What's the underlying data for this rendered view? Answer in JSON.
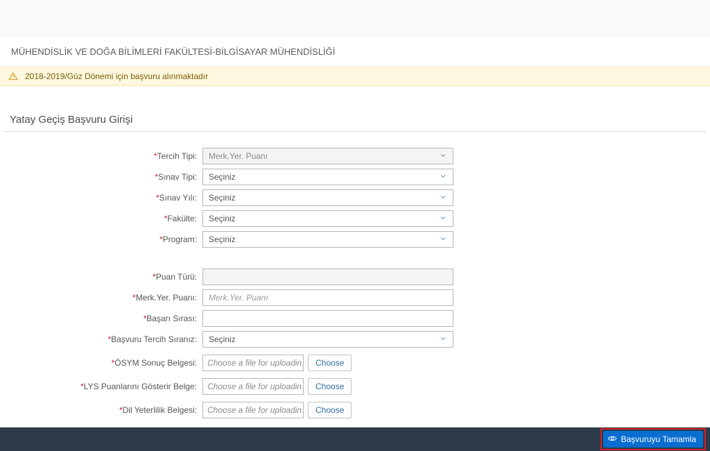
{
  "header": {
    "faculty_line": "MÜHENDİSLİK VE DOĞA BİLİMLERİ FAKÜLTESİ-BİLGİSAYAR MÜHENDİSLİĞİ"
  },
  "warning": {
    "text": "2018-2019/Güz Dönemi için başvuru alınmaktadır"
  },
  "section": {
    "title": "Yatay Geçiş Başvuru Girişi"
  },
  "labels": {
    "tercih_tipi": "Tercih Tipi:",
    "sinav_tipi": "Sınav Tipi:",
    "sinav_yili": "Sınav Yılı:",
    "fakulte": "Fakülte:",
    "program": "Program:",
    "puan_turu": "Puan Türü:",
    "merk_yer_puani": "Merk.Yer. Puanı:",
    "basari_sirasi": "Başarı Sırası:",
    "basvuru_tercih_siraniz": "Başvuru Tercih Sıranız:",
    "osym_sonuc": "ÖSYM Sonuç Belgesi:",
    "lys_puan": "LYS Puanlarını Gösterir Belge:",
    "dil_yeterlilik": "Dil Yeterlilik Belgesi:"
  },
  "values": {
    "tercih_tipi": "Merk.Yer. Puanı",
    "secininiz": "Seçiniz",
    "file_placeholder": "Choose a file for uploadin…",
    "choose": "Choose",
    "merk_placeholder": "Merk.Yer. Puanı"
  },
  "footer": {
    "complete": "Başvuruyu Tamamla"
  }
}
